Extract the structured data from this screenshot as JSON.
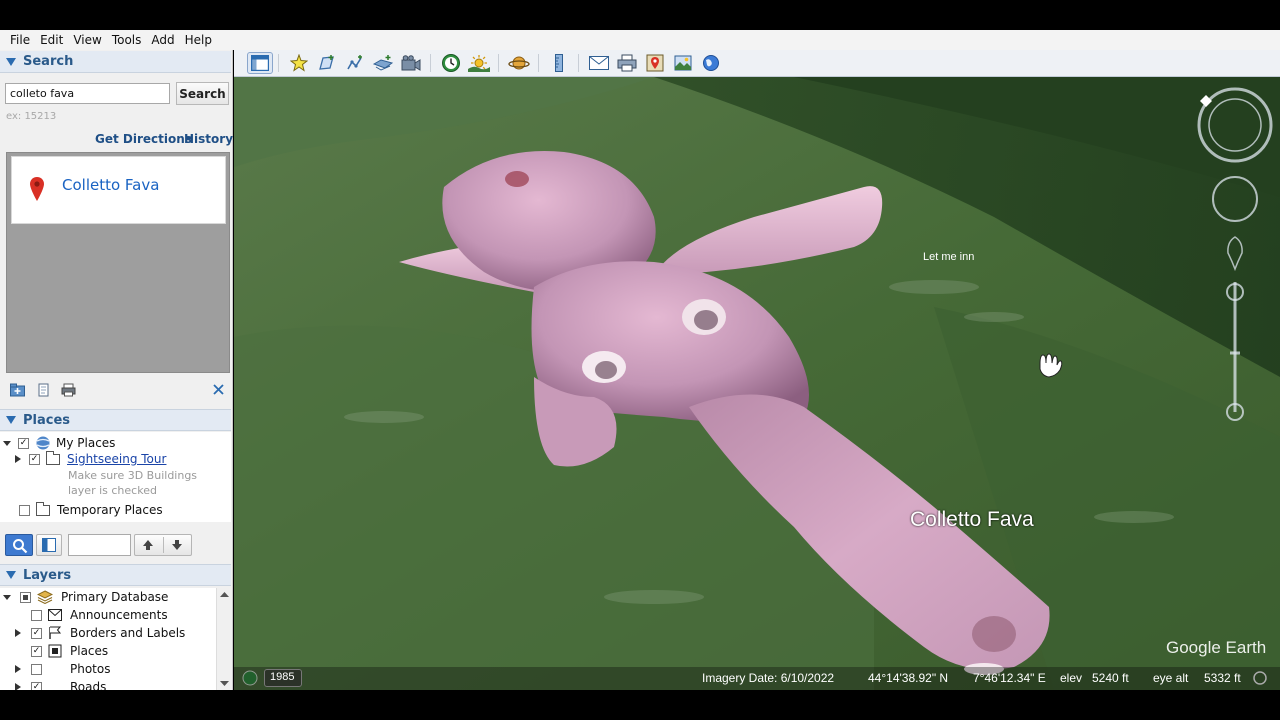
{
  "menu": [
    "File",
    "Edit",
    "View",
    "Tools",
    "Add",
    "Help"
  ],
  "search": {
    "header": "Search",
    "query": "colleto fava",
    "button_label": "Search",
    "hint": "ex: 15213",
    "get_directions": "Get Directions",
    "history": "History",
    "result_title": "Colletto Fava"
  },
  "places": {
    "header": "Places",
    "my_places": "My Places",
    "sightseeing_tour": "Sightseeing Tour",
    "tour_note_1": "Make sure 3D Buildings",
    "tour_note_2": "layer is checked",
    "temporary_places": "Temporary Places"
  },
  "layers": {
    "header": "Layers",
    "items": [
      {
        "label": "Primary Database"
      },
      {
        "label": "Announcements"
      },
      {
        "label": "Borders and Labels"
      },
      {
        "label": "Places"
      },
      {
        "label": "Photos"
      },
      {
        "label": "Roads"
      }
    ]
  },
  "map": {
    "label_let_me_in": "Let me inn",
    "label_place": "Colletto Fava",
    "brand": "Google Earth"
  },
  "status": {
    "historical_year": "1985",
    "imagery_date": "Imagery Date: 6/10/2022",
    "lat": "44°14'38.92\" N",
    "lon": "7°46'12.34\" E",
    "elev_label": "elev",
    "elev_value": "5240 ft",
    "eye_alt_label": "eye alt",
    "eye_alt_value": "5332 ft"
  },
  "colors": {
    "header_blue": "#2a5a8a",
    "link_blue": "#1f4f86",
    "result_blue": "#1a63c2",
    "pin_red": "#d93025",
    "terrain_green": "#3f5e33",
    "model_pink": "#c897b8"
  }
}
